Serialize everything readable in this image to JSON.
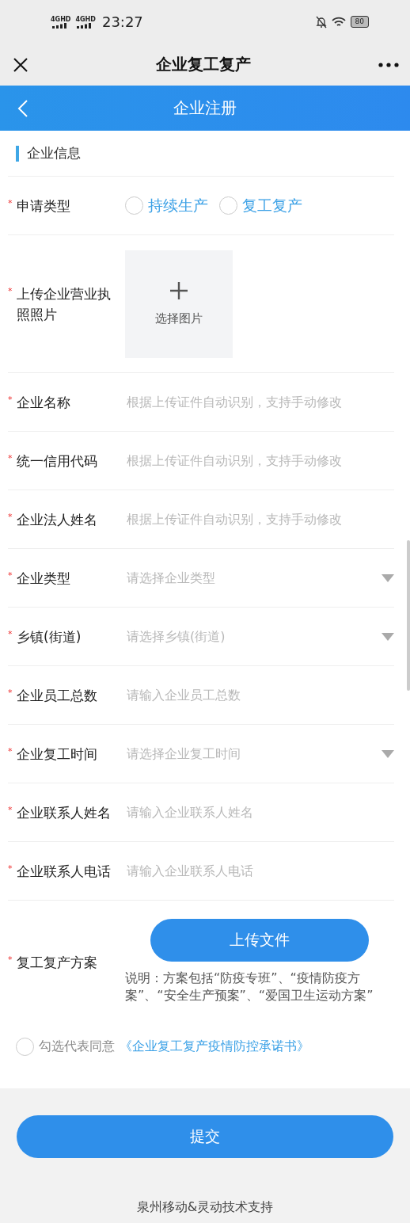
{
  "status_bar": {
    "networks": [
      "4GHD",
      "4GHD"
    ],
    "time": "23:27",
    "battery": "80"
  },
  "nav_bar": {
    "title": "企业复工复产"
  },
  "header": {
    "title": "企业注册"
  },
  "section": {
    "title": "企业信息"
  },
  "apply_type": {
    "label": "申请类型",
    "required_mark": "*",
    "options": [
      {
        "label": "持续生产",
        "selected": false
      },
      {
        "label": "复工复产",
        "selected": false
      }
    ]
  },
  "license_upload": {
    "label": "上传企业营业执照照片",
    "required_mark": "*",
    "button": "选择图片"
  },
  "fields": [
    {
      "label": "企业名称",
      "required_mark": "*",
      "kind": "text",
      "placeholder": "根据上传证件自动识别，支持手动修改"
    },
    {
      "label": "统一信用代码",
      "required_mark": "*",
      "kind": "text",
      "placeholder": "根据上传证件自动识别，支持手动修改"
    },
    {
      "label": "企业法人姓名",
      "required_mark": "*",
      "kind": "text",
      "placeholder": "根据上传证件自动识别，支持手动修改"
    },
    {
      "label": "企业类型",
      "required_mark": "*",
      "kind": "select",
      "placeholder": "请选择企业类型"
    },
    {
      "label": "乡镇(街道)",
      "required_mark": "*",
      "kind": "select",
      "placeholder": "请选择乡镇(街道)"
    },
    {
      "label": "企业员工总数",
      "required_mark": "*",
      "kind": "text",
      "placeholder": "请输入企业员工总数"
    },
    {
      "label": "企业复工时间",
      "required_mark": "*",
      "kind": "select",
      "placeholder": "请选择企业复工时间"
    },
    {
      "label": "企业联系人姓名",
      "required_mark": "*",
      "kind": "text",
      "placeholder": "请输入企业联系人姓名"
    },
    {
      "label": "企业联系人电话",
      "required_mark": "*",
      "kind": "text",
      "placeholder": "请输入企业联系人电话"
    }
  ],
  "plan": {
    "label": "复工复产方案",
    "required_mark": "*",
    "button": "上传文件",
    "note": "说明：方案包括“防疫专班”、“疫情防疫方案”、“安全生产预案”、“爱国卫生运动方案”"
  },
  "agreement": {
    "checked": false,
    "text": "勾选代表同意",
    "link": "《企业复工复产疫情防控承诺书》"
  },
  "submit": "提交",
  "footer": "泉州移动&灵动技术支持"
}
